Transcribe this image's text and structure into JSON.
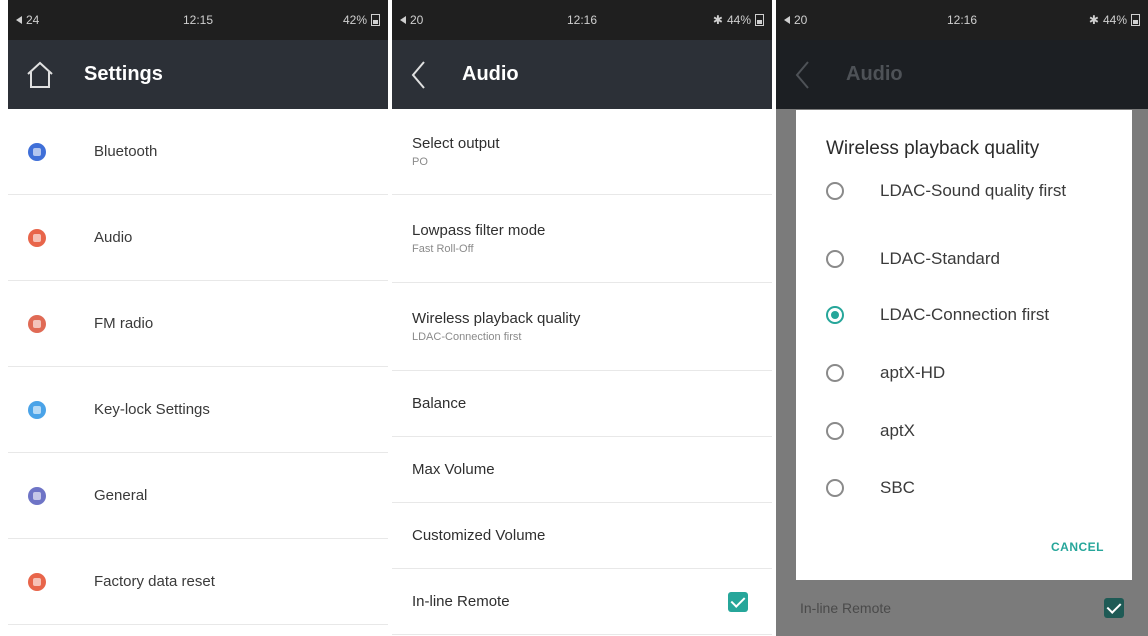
{
  "screens": {
    "settings": {
      "status": {
        "volume": "24",
        "time": "12:15",
        "battery": "42%"
      },
      "title": "Settings",
      "items": [
        {
          "label": "Bluetooth",
          "color": "#3f6fd8"
        },
        {
          "label": "Audio",
          "color": "#e8654a"
        },
        {
          "label": "FM radio",
          "color": "#e06a55"
        },
        {
          "label": "Key-lock Settings",
          "color": "#4aa3e8"
        },
        {
          "label": "General",
          "color": "#6e74c6"
        },
        {
          "label": "Factory data reset",
          "color": "#e8654a"
        }
      ]
    },
    "audio": {
      "status": {
        "volume": "20",
        "time": "12:16",
        "battery": "44%"
      },
      "title": "Audio",
      "items": [
        {
          "title": "Select output",
          "subtitle": "PO"
        },
        {
          "title": "Lowpass filter mode",
          "subtitle": "Fast Roll-Off"
        },
        {
          "title": "Wireless playback quality",
          "subtitle": "LDAC-Connection first"
        },
        {
          "title": "Balance"
        },
        {
          "title": "Max Volume"
        },
        {
          "title": "Customized Volume"
        },
        {
          "title": "In-line Remote",
          "checked": true
        }
      ]
    },
    "dialog_screen": {
      "status": {
        "volume": "20",
        "time": "12:16",
        "battery": "44%"
      },
      "title": "Audio",
      "under_row": "In-line Remote",
      "dialog": {
        "title": "Wireless playback quality",
        "options": [
          {
            "label": "LDAC-Sound quality first",
            "selected": false
          },
          {
            "label": "LDAC-Standard",
            "selected": false
          },
          {
            "label": "LDAC-Connection first",
            "selected": true
          },
          {
            "label": "aptX-HD",
            "selected": false
          },
          {
            "label": "aptX",
            "selected": false
          },
          {
            "label": "SBC",
            "selected": false
          }
        ],
        "cancel": "CANCEL"
      }
    }
  },
  "colors": {
    "accent": "#26a69a",
    "appbar": "#2c3037"
  }
}
